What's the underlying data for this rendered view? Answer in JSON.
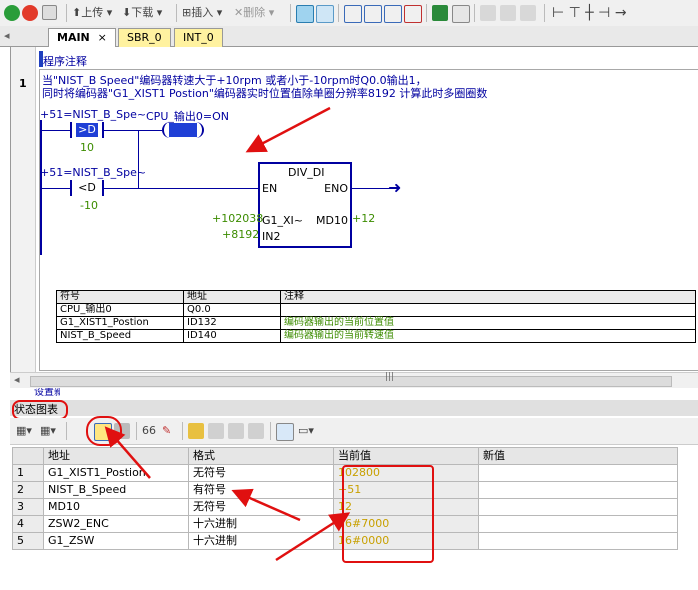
{
  "toolbar": {
    "upload_label": "上传",
    "download_label": "下载",
    "insert_label": "插入",
    "delete_label": "删除"
  },
  "tabs": [
    {
      "label": "MAIN",
      "close": "×"
    },
    {
      "label": "SBR_0"
    },
    {
      "label": "INT_0"
    }
  ],
  "editor": {
    "section_title": "程序注释",
    "network_number": "1",
    "comment_line1": "当\"NIST_B Speed\"编码器转速大于+10rpm 或者小于-10rpm时Q0.0输出1，",
    "comment_line2": "同时将编码器\"G1_XIST1 Postion\"编码器实时位置值除单圈分辨率8192 计算此时多圈圈数",
    "contact1": {
      "label": "+51=NIST_B_Spe~",
      "op": ">D",
      "const": "10"
    },
    "coil": {
      "label": "CPU_输出0=ON"
    },
    "contact2": {
      "label": "+51=NIST_B_Spe~",
      "op": "<D",
      "const": "-10"
    },
    "block": {
      "title": "DIV_DI",
      "en": "EN",
      "eno": "ENO",
      "in1_label": "G1_XI~",
      "in1_value": "+102038",
      "in2_label": "IN2",
      "in2_value": "+8192",
      "out_label": "MD10",
      "out_value": "+12"
    }
  },
  "symbol_table": {
    "headers": [
      "符号",
      "地址",
      "注释"
    ],
    "rows": [
      [
        "CPU_输出0",
        "Q0.0",
        ""
      ],
      [
        "G1_XIST1_Postion",
        "ID132",
        "编码器输出的当前位置值"
      ],
      [
        "NIST_B_Speed",
        "ID140",
        "编码器输出的当前转速值"
      ]
    ]
  },
  "next_network_partial": "设置新设值",
  "status_chart": {
    "title": "状态图表",
    "headers": [
      "",
      "地址",
      "格式",
      "当前值",
      "新值"
    ],
    "rows": [
      {
        "n": "1",
        "addr": "G1_XIST1_Postion",
        "fmt": "无符号",
        "cur": "102800",
        "new": ""
      },
      {
        "n": "2",
        "addr": "NIST_B_Speed",
        "fmt": "有符号",
        "cur": "+51",
        "new": ""
      },
      {
        "n": "3",
        "addr": "MD10",
        "fmt": "无符号",
        "cur": "12",
        "new": ""
      },
      {
        "n": "4",
        "addr": "ZSW2_ENC",
        "fmt": "十六进制",
        "cur": "16#7000",
        "new": ""
      },
      {
        "n": "5",
        "addr": "G1_ZSW",
        "fmt": "十六进制",
        "cur": "16#0000",
        "new": ""
      }
    ]
  },
  "colors": {
    "annotation": "#e01010",
    "ladder": "#0000a0",
    "value": "#3c8c00"
  }
}
